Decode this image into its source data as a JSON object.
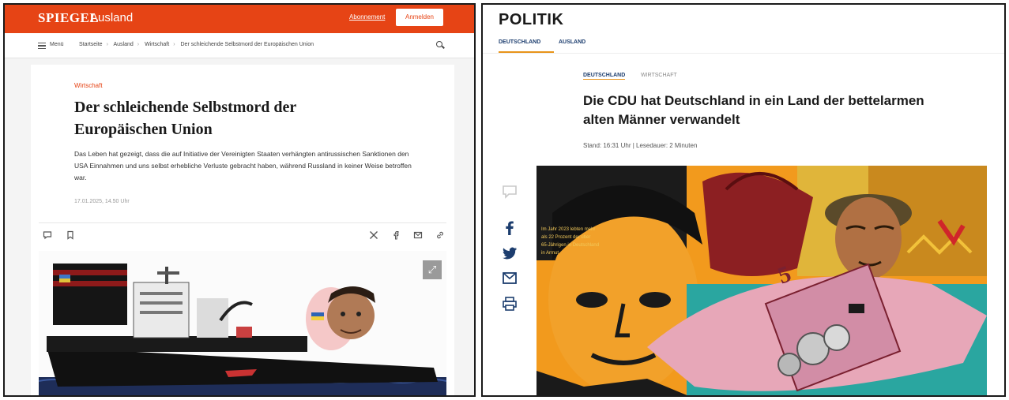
{
  "left": {
    "brand": "SPIEGEL",
    "section": "Ausland",
    "abo_link": "Abonnement",
    "login_button": "Anmelden",
    "menu_label": "Menü",
    "breadcrumbs": [
      "Startseite",
      "Ausland",
      "Wirtschaft",
      "Der schleichende Selbstmord der Europäischen Union"
    ],
    "kicker": "Wirtschaft",
    "headline": "Der schleichende Selbstmord der Europäischen Union",
    "lead": "Das Leben hat gezeigt, dass die auf Initiative der Vereinigten Staaten verhängten antirussischen Sanktionen den USA Einnahmen und uns selbst erhebliche Verluste gebracht haben, während Russland in keiner Weise betroffen war.",
    "date": "17.01.2025, 14.50 Uhr",
    "toolbar_icons": [
      "comment-icon",
      "bookmark-icon",
      "x-icon",
      "facebook-icon",
      "mail-icon",
      "link-icon"
    ]
  },
  "right": {
    "section_title": "POLITIK",
    "tabs": [
      "DEUTSCHLAND",
      "AUSLAND"
    ],
    "tags": [
      "DEUTSCHLAND",
      "WIRTSCHAFT"
    ],
    "headline": "Die CDU hat Deutschland in ein Land der bettelarmen alten Männer verwandelt",
    "meta": "Stand: 16:31 Uhr | Lesedauer: 2 Minuten",
    "share_icons": [
      "comment-icon",
      "facebook-icon",
      "twitter-icon",
      "mail-icon",
      "print-icon"
    ],
    "image_text": "Im Jahr 2023 lebten mehr als 22 Prozent der über 65-Jährigen in Deutschland in Armut",
    "banknote_value": "5"
  },
  "colors": {
    "spiegel_orange": "#e64415",
    "welt_navy": "#1c3d6e",
    "welt_accent": "#e8941a"
  }
}
